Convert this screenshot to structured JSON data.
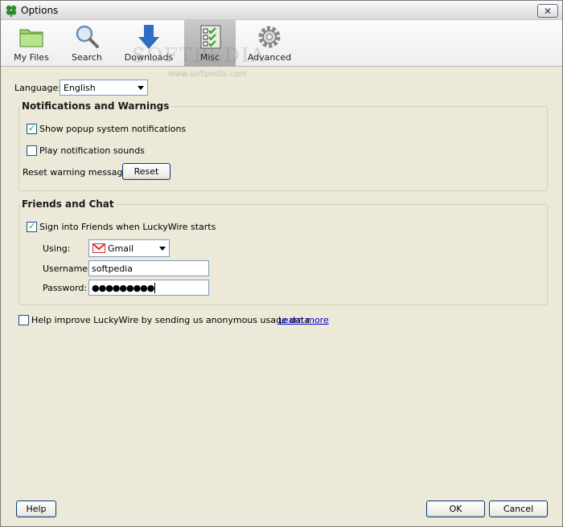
{
  "window": {
    "title": "Options"
  },
  "toolbar": {
    "tabs": [
      {
        "label": "My Files",
        "icon": "folder-icon"
      },
      {
        "label": "Search",
        "icon": "magnifier-icon"
      },
      {
        "label": "Downloads",
        "icon": "download-arrow-icon"
      },
      {
        "label": "Misc",
        "icon": "checklist-icon",
        "active": true
      },
      {
        "label": "Advanced",
        "icon": "gear-icon"
      }
    ],
    "watermark": "SOFTPEDIA",
    "watermark_url": "www.softpedia.com"
  },
  "language": {
    "label": "Language:",
    "value": "English"
  },
  "notifications": {
    "title": "Notifications and Warnings",
    "show_popup_label": "Show popup system notifications",
    "show_popup_checked": true,
    "play_sounds_label": "Play notification sounds",
    "play_sounds_checked": false,
    "reset_label": "Reset warning messages",
    "reset_button": "Reset"
  },
  "friends": {
    "title": "Friends and Chat",
    "sign_in_label": "Sign into Friends when LuckyWire starts",
    "sign_in_checked": true,
    "using_label": "Using:",
    "using_value": "Gmail",
    "username_label": "Username:",
    "username_value": "softpedia",
    "password_label": "Password:",
    "password_value": "●●●●●●●●●"
  },
  "usage": {
    "label": "Help improve LuckyWire by sending us anonymous usage data",
    "checked": false,
    "learn_more": "Learn more"
  },
  "footer": {
    "help": "Help",
    "ok": "OK",
    "cancel": "Cancel"
  },
  "colors": {
    "link": "#0000cc",
    "checkmark": "#21a121",
    "dialog_bg": "#ece9d8",
    "gmail_red": "#d93025"
  }
}
